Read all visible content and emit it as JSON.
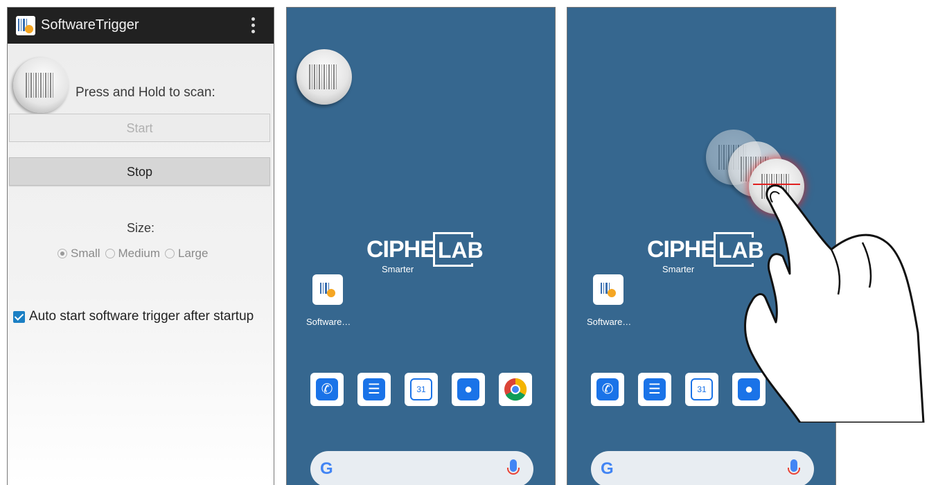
{
  "app": {
    "title": "SoftwareTrigger",
    "scan_label": "Press and Hold to scan:",
    "start_label": "Start",
    "stop_label": "Stop",
    "size_label": "Size:",
    "size_options": [
      "Small",
      "Medium",
      "Large"
    ],
    "size_selected": "Small",
    "auto_start_label": "Auto start software trigger after startup",
    "auto_start_checked": true
  },
  "home": {
    "logo_left": "CIPHER",
    "logo_right": "LAB",
    "logo_tagline": "Smarter",
    "shortcut_label": "Software…",
    "dock_icons": [
      "phone-icon",
      "messages-icon",
      "calendar-icon",
      "contacts-icon",
      "chrome-icon"
    ],
    "calendar_day": "31",
    "search_logo": "G"
  },
  "colors": {
    "appbar": "#212121",
    "home_background": "#36678f",
    "checkbox": "#1b7fc4",
    "dock_blue": "#1a73e8"
  }
}
